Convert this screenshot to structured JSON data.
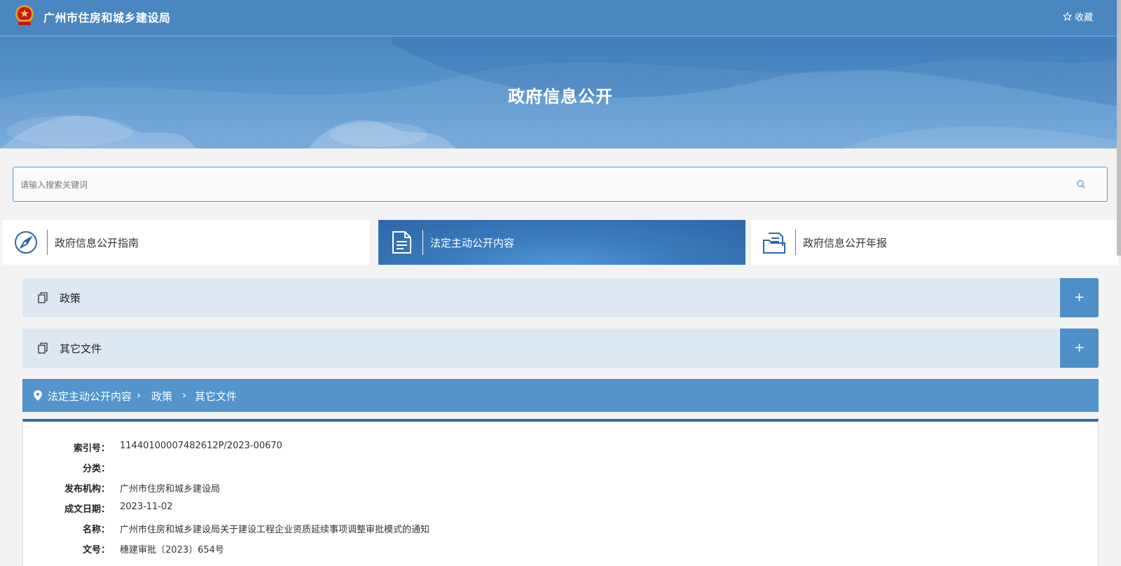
{
  "header": {
    "site_title": "广州市住房和城乡建设局",
    "favorite_label": "收藏"
  },
  "banner": {
    "title": "政府信息公开"
  },
  "search": {
    "placeholder": "请输入搜索关键词",
    "value": ""
  },
  "tabs": [
    {
      "label": "政府信息公开指南",
      "icon": "compass-icon",
      "active": false
    },
    {
      "label": "法定主动公开内容",
      "icon": "document-icon",
      "active": true
    },
    {
      "label": "政府信息公开年报",
      "icon": "folder-icon",
      "active": false
    }
  ],
  "accordions": [
    {
      "label": "政策",
      "toggle": "+"
    },
    {
      "label": "其它文件",
      "toggle": "+"
    }
  ],
  "breadcrumb": {
    "items": [
      "法定主动公开内容",
      "政策",
      "其它文件"
    ]
  },
  "details": [
    {
      "key": "索引号：",
      "value": "11440100007482612P/2023-00670"
    },
    {
      "key": "分类：",
      "value": ""
    },
    {
      "key": "发布机构：",
      "value": "广州市住房和城乡建设局"
    },
    {
      "key": "成文日期：",
      "value": "2023-11-02"
    },
    {
      "key": "名称：",
      "value": "广州市住房和城乡建设局关于建设工程企业资质延续事项调整审批模式的通知"
    },
    {
      "key": "文号：",
      "value": "穗建审批〔2023〕654号"
    }
  ],
  "colors": {
    "primary": "#4a87c0",
    "active_tab": "#2e66a6",
    "accordion_bg": "#dde8f2",
    "breadcrumb_bg": "#5394cc"
  }
}
